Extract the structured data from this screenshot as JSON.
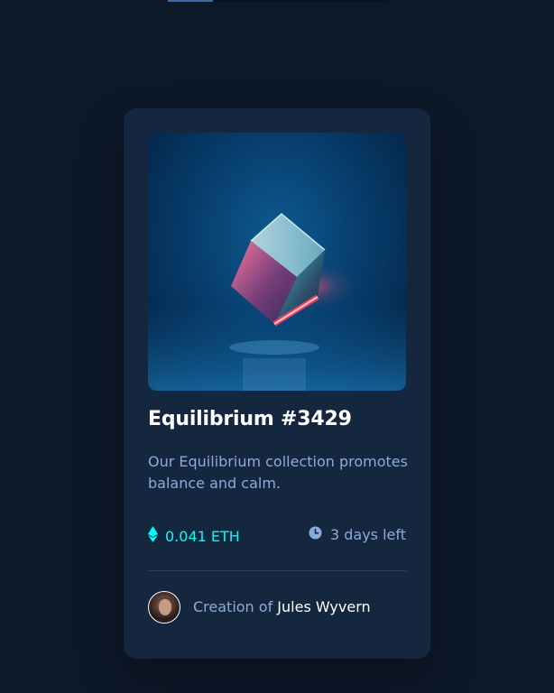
{
  "card": {
    "title": "Equilibrium #3429",
    "description": "Our Equilibrium collection promotes balance and calm.",
    "price": "0.041 ETH",
    "time_left": "3 days left",
    "creator_prefix": "Creation of",
    "creator_name": "Jules Wyvern"
  },
  "icons": {
    "price": "ethereum-icon",
    "time": "clock-icon",
    "creator": "avatar"
  },
  "colors": {
    "background": "#0d1829",
    "card": "#15263f",
    "accent": "#00fff8",
    "muted": "#8bacd9",
    "white": "#ffffff"
  }
}
